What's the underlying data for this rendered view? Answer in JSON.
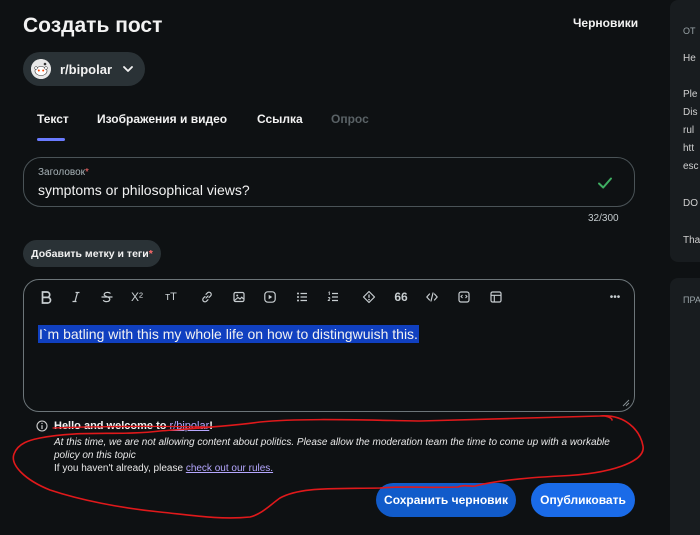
{
  "header": {
    "title": "Создать пост",
    "drafts_label": "Черновики"
  },
  "community": {
    "name": "r/bipolar"
  },
  "tabs": [
    {
      "label": "Текст",
      "active": true
    },
    {
      "label": "Изображения и видео",
      "active": false
    },
    {
      "label": "Ссылка",
      "active": false
    },
    {
      "label": "Опрос",
      "active": false,
      "disabled": true
    }
  ],
  "title_field": {
    "label": "Заголовок",
    "required_mark": "*",
    "value": "symptoms or philosophical views?",
    "char_count": "32/300"
  },
  "tags_button": {
    "label": "Добавить метку и теги",
    "required_mark": "*"
  },
  "editor": {
    "toolbar": [
      "bold-icon",
      "italic-icon",
      "strikethrough-icon",
      "superscript-icon",
      "heading-icon",
      "link-icon",
      "image-icon",
      "video-icon",
      "bullet-list-icon",
      "numbered-list-icon",
      "spoiler-icon",
      "quote-icon",
      "code-icon",
      "code-block-icon",
      "table-icon",
      "more-icon"
    ],
    "toolbar_glyphs": {
      "superscript": "X²",
      "heading": "тТ",
      "quote": "66",
      "more": "•••"
    },
    "body_text": "I`m batling with this my whole life on how to distingwuish this."
  },
  "rules": {
    "welcome_prefix": "Hello and welcome to ",
    "subreddit_link": "r/bipolar",
    "welcome_suffix": "!",
    "notice": "At this time, we are not allowing content about politics. Please allow the moderation team the time to come up with a workable policy on this topic",
    "rules_prefix": "If you haven't already, please ",
    "rules_link": "check out our rules."
  },
  "actions": {
    "save_draft": "Сохранить черновик",
    "publish": "Опубликовать"
  },
  "right_panel": {
    "top_heading": "ОТ",
    "lines": [
      "He",
      "Ple",
      "Dis",
      "rul",
      "htt",
      "esc",
      "DO",
      "Tha"
    ],
    "bottom_heading": "ПРА"
  },
  "colors": {
    "background": "#0e1113",
    "accent": "#1a6be8",
    "tab_underline": "#6a7bff",
    "link": "#b5a7ff",
    "selection": "#1040c0",
    "annotation": "#e0191b"
  }
}
